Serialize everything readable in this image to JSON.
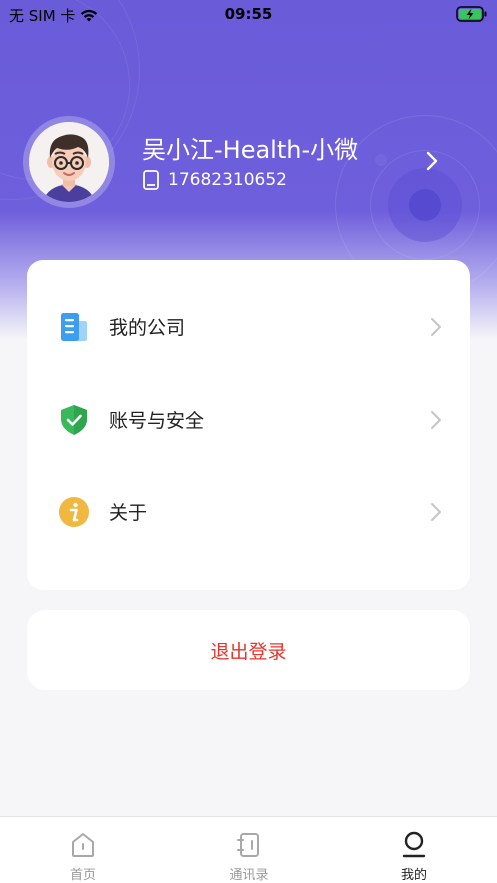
{
  "status_bar": {
    "carrier": "无 SIM 卡",
    "time": "09:55",
    "wifi_icon": "wifi-icon",
    "battery_icon": "battery-charging-icon"
  },
  "profile": {
    "name": "吴小江-Health-小微",
    "phone": "17682310652",
    "avatar_icon": "avatar-illustration",
    "phone_icon": "phone-icon",
    "chevron_icon": "chevron-right-icon"
  },
  "menu": {
    "items": [
      {
        "label": "我的公司",
        "icon": "company-icon"
      },
      {
        "label": "账号与安全",
        "icon": "shield-check-icon"
      },
      {
        "label": "关于",
        "icon": "info-icon"
      }
    ]
  },
  "logout": {
    "label": "退出登录"
  },
  "tab_bar": {
    "tabs": [
      {
        "label": "首页",
        "icon": "home-icon",
        "active": false
      },
      {
        "label": "通讯录",
        "icon": "contacts-icon",
        "active": false
      },
      {
        "label": "我的",
        "icon": "profile-icon",
        "active": true
      }
    ]
  },
  "colors": {
    "header": "#6a5bd9",
    "logout_text": "#e5352b",
    "background": "#f6f6f8"
  }
}
